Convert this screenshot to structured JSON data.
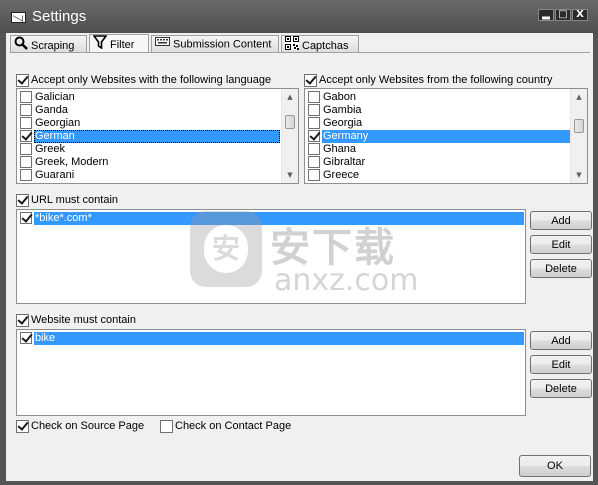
{
  "window": {
    "title": "Settings",
    "buttons": {
      "minimize": "▂",
      "maximize": "□",
      "close": "X"
    }
  },
  "tabs": [
    {
      "label": "Scraping",
      "icon": "magnifier-icon"
    },
    {
      "label": "Filter",
      "icon": "funnel-icon",
      "active": true
    },
    {
      "label": "Submission Content",
      "icon": "keyboard-icon"
    },
    {
      "label": "Captchas",
      "icon": "qr-code-icon"
    }
  ],
  "language": {
    "checkbox_label": "Accept only Websites with the following language",
    "checked": true,
    "items": [
      {
        "label": "Galician",
        "checked": false
      },
      {
        "label": "Ganda",
        "checked": false
      },
      {
        "label": "Georgian",
        "checked": false
      },
      {
        "label": "German",
        "checked": true,
        "selected": true
      },
      {
        "label": "Greek",
        "checked": false
      },
      {
        "label": "Greek, Modern",
        "checked": false
      },
      {
        "label": "Guarani",
        "checked": false
      }
    ]
  },
  "country": {
    "checkbox_label": "Accept only Websites from the following country",
    "checked": true,
    "items": [
      {
        "label": "Gabon",
        "checked": false
      },
      {
        "label": "Gambia",
        "checked": false
      },
      {
        "label": "Georgia",
        "checked": false
      },
      {
        "label": "Germany",
        "checked": true,
        "selected": true
      },
      {
        "label": "Ghana",
        "checked": false
      },
      {
        "label": "Gibraltar",
        "checked": false
      },
      {
        "label": "Greece",
        "checked": false
      }
    ]
  },
  "url_filter": {
    "checkbox_label": "URL must contain",
    "checked": true,
    "items": [
      {
        "label": "*bike*.com*",
        "checked": true
      }
    ],
    "buttons": {
      "add": "Add",
      "edit": "Edit",
      "delete": "Delete"
    }
  },
  "content_filter": {
    "checkbox_label": "Website must contain",
    "checked": true,
    "items": [
      {
        "label": "bike",
        "checked": true
      }
    ],
    "buttons": {
      "add": "Add",
      "edit": "Edit",
      "delete": "Delete"
    }
  },
  "options": {
    "source_page": {
      "label": "Check on Source Page",
      "checked": true
    },
    "contact_page": {
      "label": "Check on Contact Page",
      "checked": false
    }
  },
  "ok_button": "OK",
  "watermark": {
    "cn": "安下载",
    "en": "anxz.com",
    "shield": "安"
  }
}
